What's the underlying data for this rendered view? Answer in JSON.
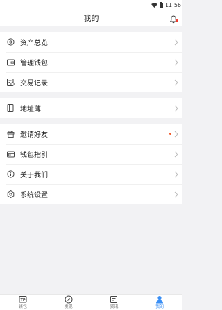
{
  "status": {
    "time": "11:56"
  },
  "header": {
    "title": "我的"
  },
  "groups": {
    "g1": [
      "资产总览",
      "管理钱包",
      "交易记录"
    ],
    "g2": [
      "地址薄"
    ],
    "g3": [
      "邀请好友",
      "钱包指引",
      "关于我们",
      "系统设置"
    ]
  },
  "tabs": [
    "钱包",
    "发现",
    "资讯",
    "我的"
  ],
  "colors": {
    "accent": "#3a8ff5",
    "badge": "#f25a2a"
  }
}
